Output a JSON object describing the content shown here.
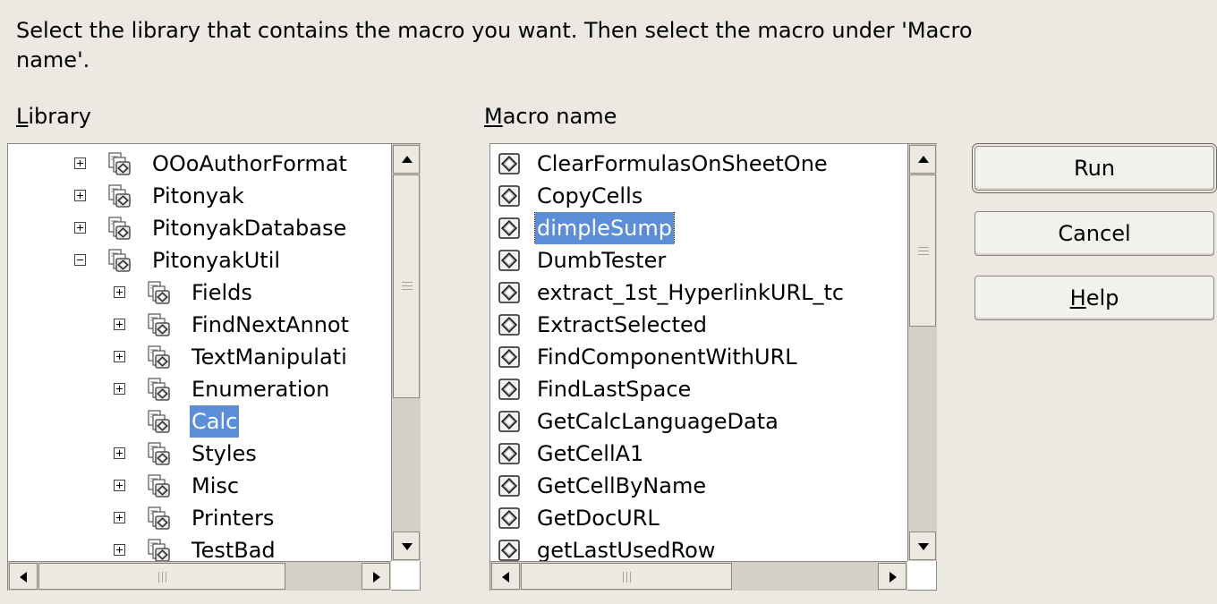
{
  "instructions": "Select the library that contains the macro you want. Then select the macro under 'Macro name'.",
  "library_label": {
    "accel": "L",
    "rest": "ibrary"
  },
  "macro_label": {
    "accel": "M",
    "rest": "acro name"
  },
  "library_items": [
    {
      "label": "OOoAuthorFormat",
      "expander": "plus",
      "level": 0
    },
    {
      "label": "Pitonyak",
      "expander": "plus",
      "level": 0
    },
    {
      "label": "PitonyakDatabase",
      "expander": "plus",
      "level": 0
    },
    {
      "label": "PitonyakUtil",
      "expander": "minus",
      "level": 0
    },
    {
      "label": "Fields",
      "expander": "plus",
      "level": 1
    },
    {
      "label": "FindNextAnnot",
      "expander": "plus",
      "level": 1
    },
    {
      "label": "TextManipulati",
      "expander": "plus",
      "level": 1
    },
    {
      "label": "Enumeration",
      "expander": "plus",
      "level": 1
    },
    {
      "label": "Calc",
      "expander": "none",
      "level": 1,
      "selected": true
    },
    {
      "label": "Styles",
      "expander": "plus",
      "level": 1
    },
    {
      "label": "Misc",
      "expander": "plus",
      "level": 1
    },
    {
      "label": "Printers",
      "expander": "plus",
      "level": 1
    },
    {
      "label": "TestBad",
      "expander": "plus",
      "level": 1
    }
  ],
  "macro_items": [
    {
      "label": "ClearFormulasOnSheetOne"
    },
    {
      "label": "CopyCells"
    },
    {
      "label": "dimpleSump",
      "selected": true
    },
    {
      "label": "DumbTester"
    },
    {
      "label": "extract_1st_HyperlinkURL_tc"
    },
    {
      "label": "ExtractSelected"
    },
    {
      "label": "FindComponentWithURL"
    },
    {
      "label": "FindLastSpace"
    },
    {
      "label": "GetCalcLanguageData"
    },
    {
      "label": "GetCellA1"
    },
    {
      "label": "GetCellByName"
    },
    {
      "label": "GetDocURL"
    },
    {
      "label": "getLastUsedRow"
    }
  ],
  "buttons": {
    "run": "Run",
    "cancel": "Cancel",
    "help": {
      "accel": "H",
      "rest": "elp"
    }
  },
  "colors": {
    "selection": "#5b8ed6",
    "background": "#ece9e2"
  }
}
